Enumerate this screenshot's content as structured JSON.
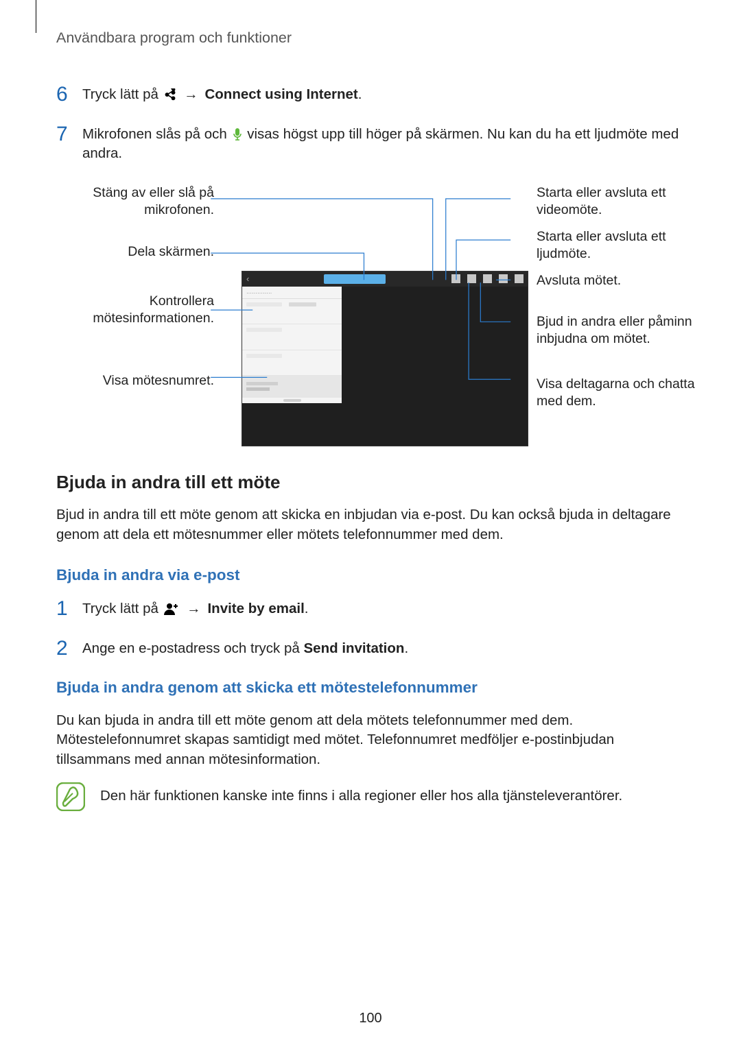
{
  "header": "Användbara program och funktioner",
  "step6": {
    "num": "6",
    "pre": "Tryck lätt på ",
    "arrow": "→",
    "bold": "Connect using Internet",
    "after": "."
  },
  "step7": {
    "num": "7",
    "pre": "Mikrofonen slås på och ",
    "mid": " visas högst upp till höger på skärmen. Nu kan du ha ett ljudmöte med andra."
  },
  "diagram": {
    "left": {
      "mic": "Stäng av eller slå på mikrofonen.",
      "share": "Dela skärmen.",
      "info": "Kontrollera mötesinformationen.",
      "number": "Visa mötesnumret."
    },
    "right": {
      "video": "Starta eller avsluta ett videomöte.",
      "audio": "Starta eller avsluta ett ljudmöte.",
      "end": "Avsluta mötet.",
      "invite": "Bjud in andra eller påminn inbjudna om mötet.",
      "participants": "Visa deltagarna och chatta med dem."
    }
  },
  "h2": "Bjuda in andra till ett möte",
  "para1": "Bjud in andra till ett möte genom att skicka en inbjudan via e-post. Du kan också bjuda in deltagare genom att dela ett mötesnummer eller mötets telefonnummer med dem.",
  "h3_email": "Bjuda in andra via e-post",
  "step1": {
    "num": "1",
    "pre": "Tryck lätt på ",
    "arrow": "→",
    "bold": "Invite by email",
    "after": "."
  },
  "step2": {
    "num": "2",
    "pre": "Ange en e-postadress och tryck på ",
    "bold": "Send invitation",
    "after": "."
  },
  "h3_phone": "Bjuda in andra genom att skicka ett mötestelefonnummer",
  "para2": "Du kan bjuda in andra till ett möte genom att dela mötets telefonnummer med dem. Mötestelefonnumret skapas samtidigt med mötet. Telefonnumret medföljer e-postinbjudan tillsammans med annan mötesinformation.",
  "note": "Den här funktionen kanske inte finns i alla regioner eller hos alla tjänsteleverantörer.",
  "page_num": "100"
}
